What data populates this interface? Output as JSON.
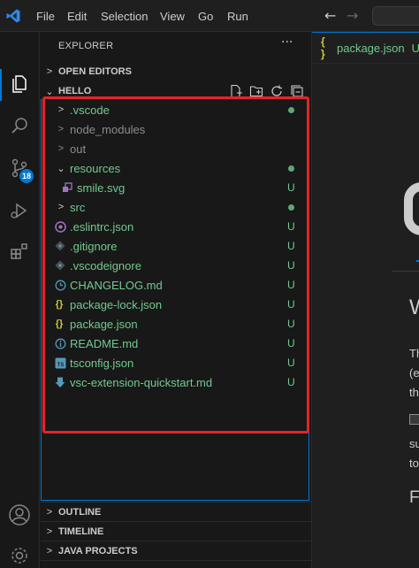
{
  "menu": [
    "File",
    "Edit",
    "Selection",
    "View",
    "Go",
    "Run"
  ],
  "sidebar": {
    "title": "EXPLORER",
    "more": "···",
    "sections": {
      "open_editors": "OPEN EDITORS",
      "hello": "HELLO",
      "outline": "OUTLINE",
      "timeline": "TIMELINE",
      "java_projects": "JAVA PROJECTS"
    },
    "tree": [
      {
        "name": ".vscode",
        "type": "folder",
        "status": "dot"
      },
      {
        "name": "node_modules",
        "type": "folder",
        "status": ""
      },
      {
        "name": "out",
        "type": "folder",
        "status": ""
      },
      {
        "name": "resources",
        "type": "folder-open",
        "status": "dot"
      },
      {
        "name": "smile.svg",
        "type": "svg",
        "status": "U"
      },
      {
        "name": "src",
        "type": "folder",
        "status": "dot"
      },
      {
        "name": ".eslintrc.json",
        "type": "eslint",
        "status": "U"
      },
      {
        "name": ".gitignore",
        "type": "git",
        "status": "U"
      },
      {
        "name": ".vscodeignore",
        "type": "git",
        "status": "U"
      },
      {
        "name": "CHANGELOG.md",
        "type": "changelog",
        "status": "U"
      },
      {
        "name": "package-lock.json",
        "type": "json",
        "status": "U"
      },
      {
        "name": "package.json",
        "type": "json",
        "status": "U"
      },
      {
        "name": "README.md",
        "type": "info",
        "status": "U"
      },
      {
        "name": "tsconfig.json",
        "type": "ts",
        "status": "U"
      },
      {
        "name": "vsc-extension-quickstart.md",
        "type": "download",
        "status": "U"
      }
    ]
  },
  "activity": {
    "scm_badge": "18"
  },
  "editor": {
    "tab_icon": "{ }",
    "tab_label": "package.json",
    "tab_status": "U",
    "preview_heading": "W",
    "preview_lines": [
      "Th",
      "(e",
      "th",
      "su",
      "to"
    ],
    "preview_subheading": "Fe"
  },
  "colors": {
    "accent": "#0078d4",
    "untracked": "#73c991",
    "highlight": "#e3242b"
  }
}
